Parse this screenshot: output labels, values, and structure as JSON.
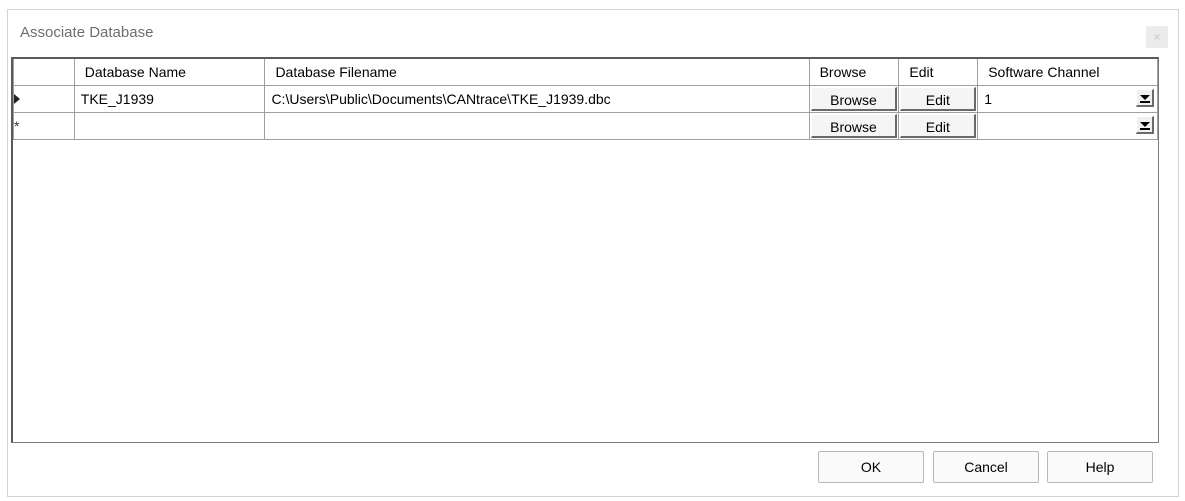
{
  "window": {
    "title": "Associate Database",
    "close_label": "×"
  },
  "grid": {
    "columns": [
      "Database Name",
      "Database Filename",
      "Browse",
      "Edit",
      "Software Channel"
    ],
    "rows": [
      {
        "indicator": "current",
        "name": "TKE_J1939",
        "filename": "C:\\Users\\Public\\Documents\\CANtrace\\TKE_J1939.dbc",
        "browse": "Browse",
        "edit": "Edit",
        "channel": "1"
      },
      {
        "indicator": "new",
        "indicator_symbol": "*",
        "name": "",
        "filename": "",
        "browse": "Browse",
        "edit": "Edit",
        "channel": ""
      }
    ]
  },
  "buttons": {
    "ok": "OK",
    "cancel": "Cancel",
    "help": "Help"
  }
}
